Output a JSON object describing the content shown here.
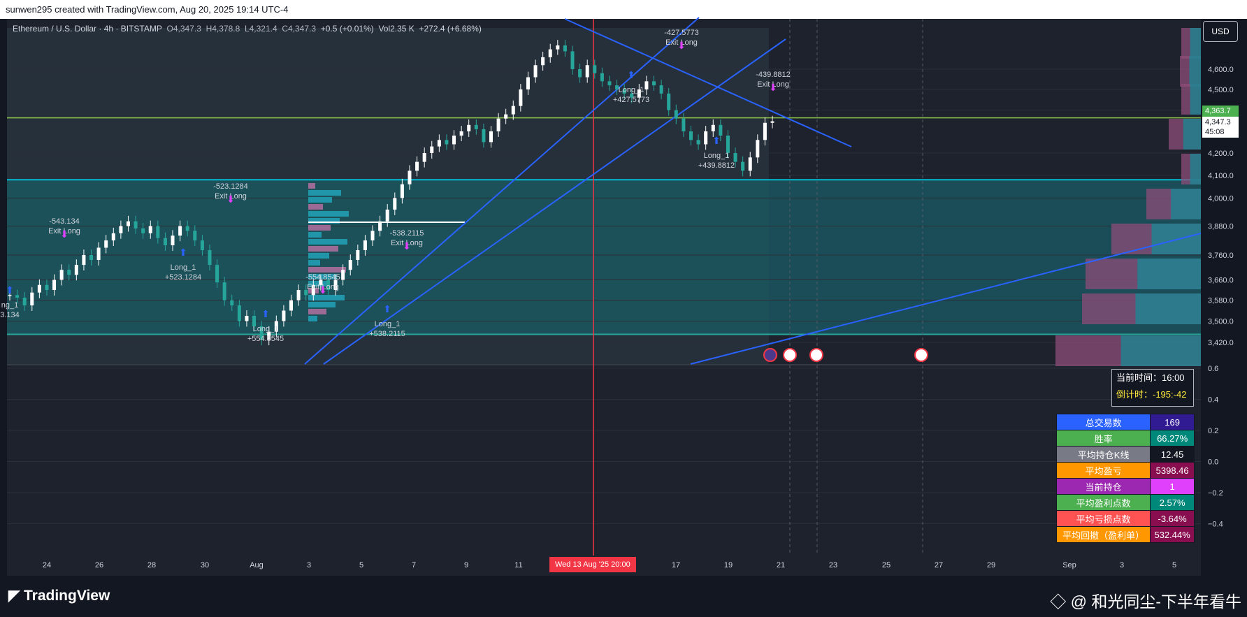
{
  "header": {
    "credit": "sunwen295 created with TradingView.com, Aug 20, 2025 19:14 UTC-4"
  },
  "legend": {
    "symbol": "Ethereum / U.S. Dollar · 4h · BITSTAMP",
    "o": "O4,347.3",
    "h": "H4,378.8",
    "l": "L4,321.4",
    "c": "C4,347.3",
    "change": "+0.5 (+0.01%)",
    "vol": "Vol2.35 K",
    "extra": "+272.4 (+6.68%)"
  },
  "currency_button": "USD",
  "price_tags": {
    "green": "4,363.7",
    "last": "4,347.3",
    "countdown": "45:08"
  },
  "crosshair_label": "Wed 13 Aug '25   20:00",
  "time_panel": {
    "now_label": "当前时间：16:00",
    "countdown_label": "倒计时：-195:-42"
  },
  "stats": [
    {
      "label": "总交易数",
      "value": "169",
      "lab_bg": "#2962ff",
      "val_bg": "#311b92"
    },
    {
      "label": "胜率",
      "value": "66.27%",
      "lab_bg": "#4caf50",
      "val_bg": "#00897b"
    },
    {
      "label": "平均持仓K线",
      "value": "12.45",
      "lab_bg": "#787b86",
      "val_bg": "#131722"
    },
    {
      "label": "平均盈亏",
      "value": "5398.46",
      "lab_bg": "#ff9800",
      "val_bg": "#880e4f"
    },
    {
      "label": "当前持仓",
      "value": "1",
      "lab_bg": "#9c27b0",
      "val_bg": "#e040fb"
    },
    {
      "label": "平均盈利点数",
      "value": "2.57%",
      "lab_bg": "#4caf50",
      "val_bg": "#00897b"
    },
    {
      "label": "平均亏损点数",
      "value": "-3.64%",
      "lab_bg": "#ff5252",
      "val_bg": "#880e4f"
    },
    {
      "label": "平均回撤（盈利单）",
      "value": "532.44%",
      "lab_bg": "#ff9800",
      "val_bg": "#880e4f"
    }
  ],
  "footer": {
    "brand": "TradingView",
    "watermark": "@ 和光同尘-下半年看牛"
  },
  "chart_data": {
    "type": "candlestick",
    "x_ticks": [
      "24",
      "26",
      "28",
      "30",
      "Aug",
      "3",
      "5",
      "7",
      "9",
      "11",
      "Wed 13 Aug '25   20:00",
      "17",
      "19",
      "21",
      "23",
      "25",
      "27",
      "29",
      "Sep",
      "3",
      "5"
    ],
    "y_ticks_price": [
      "4,600.0",
      "4,500.0",
      "4,400.0",
      "4,200.0",
      "4,100.0",
      "4,000.0",
      "3,880.0",
      "3,760.0",
      "3,660.0",
      "3,580.0",
      "3,500.0",
      "3,420.0"
    ],
    "y_ticks_indicator": [
      "0.6",
      "0.4",
      "0.2",
      "0.0",
      "−0.2",
      "−0.4"
    ],
    "y_scale": "log",
    "horizontal_levels": [
      4363.7,
      4080,
      3450
    ],
    "close_series": [
      3600,
      3590,
      3560,
      3610,
      3640,
      3620,
      3660,
      3700,
      3680,
      3720,
      3760,
      3740,
      3790,
      3820,
      3850,
      3880,
      3900,
      3870,
      3850,
      3880,
      3830,
      3800,
      3840,
      3880,
      3860,
      3820,
      3780,
      3720,
      3650,
      3580,
      3560,
      3500,
      3520,
      3480,
      3430,
      3460,
      3500,
      3540,
      3580,
      3620,
      3600,
      3640,
      3660,
      3620,
      3660,
      3700,
      3740,
      3780,
      3820,
      3860,
      3900,
      3950,
      4000,
      4060,
      4120,
      4160,
      4200,
      4230,
      4260,
      4240,
      4280,
      4300,
      4330,
      4310,
      4250,
      4300,
      4360,
      4380,
      4420,
      4500,
      4560,
      4620,
      4660,
      4700,
      4720,
      4690,
      4600,
      4560,
      4620,
      4580,
      4540,
      4520,
      4500,
      4480,
      4460,
      4500,
      4540,
      4520,
      4480,
      4400,
      4360,
      4300,
      4260,
      4240,
      4300,
      4330,
      4280,
      4200,
      4160,
      4120,
      4180,
      4260,
      4340,
      4347
    ],
    "annotations": [
      {
        "text": [
          "-543.134",
          "Exit Long"
        ],
        "kind": "exit"
      },
      {
        "text": [
          "-523.1284",
          "Exit Long"
        ],
        "kind": "exit"
      },
      {
        "text": [
          "Long_1",
          "+523.1284"
        ],
        "kind": "long"
      },
      {
        "text": [
          "Long_1",
          "+554.8545"
        ],
        "kind": "long"
      },
      {
        "text": [
          "-554.8545",
          "Exit Long"
        ],
        "kind": "exit"
      },
      {
        "text": [
          "-538.2115",
          "Exit Long"
        ],
        "kind": "exit"
      },
      {
        "text": [
          "Long_1",
          "+538.2115"
        ],
        "kind": "long"
      },
      {
        "text": [
          "-427.5773",
          "Exit Long"
        ],
        "kind": "exit"
      },
      {
        "text": [
          "Long_1",
          "+427.5773"
        ],
        "kind": "long"
      },
      {
        "text": [
          "-439.8812",
          "Exit Long"
        ],
        "kind": "exit"
      },
      {
        "text": [
          "Long_1",
          "+439.8812"
        ],
        "kind": "long"
      },
      {
        "text": [
          "ng_1",
          "3.134"
        ],
        "kind": "long"
      }
    ]
  }
}
